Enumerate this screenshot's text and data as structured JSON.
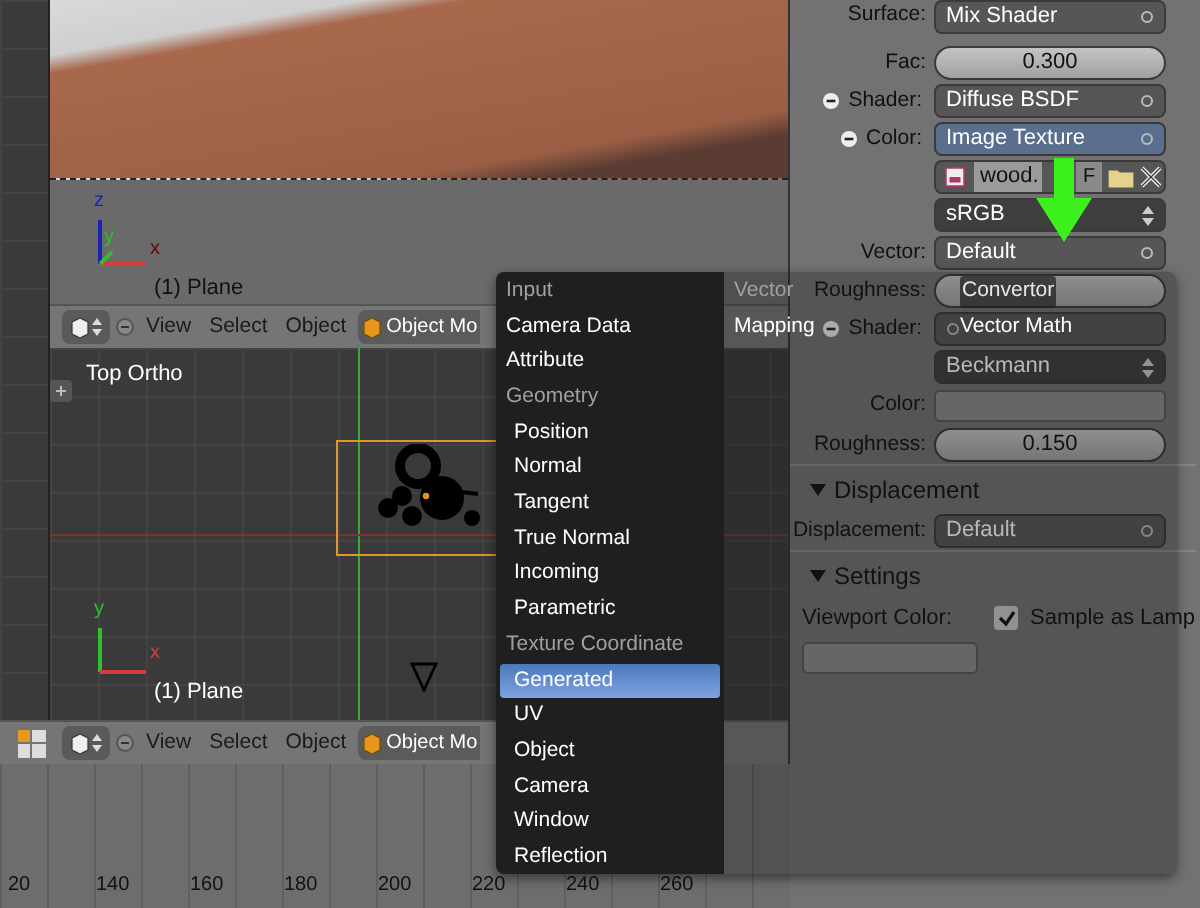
{
  "top_viewport": {
    "axes": [
      "z",
      "y",
      "x"
    ],
    "object_label": "(1) Plane"
  },
  "top_header": {
    "menus": [
      "View",
      "Select",
      "Object"
    ],
    "mode": "Object Mo"
  },
  "bottom_viewport": {
    "view_label": "Top Ortho",
    "axes": [
      "y",
      "x"
    ],
    "object_label": "(1) Plane"
  },
  "bottom_header": {
    "menus": [
      "View",
      "Select",
      "Object"
    ],
    "mode": "Object Mo"
  },
  "timeline": {
    "ticks": [
      "20",
      "140",
      "160",
      "180",
      "200",
      "220",
      "240",
      "260"
    ]
  },
  "properties": [
    {
      "kind": "select",
      "label": "Surface:",
      "value": "Mix Shader",
      "linked": false
    },
    {
      "kind": "number",
      "label": "Fac:",
      "value": "0.300",
      "linked": false
    },
    {
      "kind": "select",
      "label": "Shader:",
      "value": "Diffuse BSDF",
      "linked": true
    },
    {
      "kind": "select",
      "label": "Color:",
      "value": "Image Texture",
      "linked": true,
      "selected": true
    },
    {
      "kind": "image",
      "value": "wood.",
      "flag": "F"
    },
    {
      "kind": "enum",
      "value": "sRGB"
    },
    {
      "kind": "select",
      "label": "Vector:",
      "value": "Default",
      "linked": false
    },
    {
      "kind": "number",
      "label": "Roughness:",
      "linked": false
    },
    {
      "kind": "select",
      "label": "Shader:",
      "linked": true
    },
    {
      "kind": "enum",
      "value": "Beckmann"
    },
    {
      "kind": "color",
      "label": "Color:"
    },
    {
      "kind": "number",
      "label": "Roughness:",
      "value": "0.150",
      "linked": false
    },
    {
      "kind": "header",
      "label": "Displacement",
      "expanded": true
    },
    {
      "kind": "select",
      "label": "Displacement:",
      "value": "Default",
      "linked": false
    },
    {
      "kind": "header",
      "label": "Settings",
      "expanded": true
    },
    {
      "kind": "checkbox",
      "label": "Viewport Color:",
      "check_label": "Sample as Lamp",
      "checked": true
    },
    {
      "kind": "color"
    }
  ],
  "node_menu": {
    "columns": [
      [
        {
          "kind": "header",
          "label": "Input"
        },
        {
          "kind": "item",
          "label": "Camera Data",
          "selected": false
        },
        {
          "kind": "item",
          "label": "Attribute",
          "selected": false
        },
        {
          "kind": "header",
          "label": "Geometry",
          "children": [
            {
              "kind": "item",
              "label": "Position",
              "selected": false
            },
            {
              "kind": "item",
              "label": "Normal",
              "selected": false
            },
            {
              "kind": "item",
              "label": "Tangent",
              "selected": false
            },
            {
              "kind": "item",
              "label": "True Normal",
              "selected": false
            },
            {
              "kind": "item",
              "label": "Incoming",
              "selected": false
            },
            {
              "kind": "item",
              "label": "Parametric",
              "selected": false
            }
          ]
        },
        {
          "kind": "header",
          "label": "Texture Coordinate",
          "children": [
            {
              "kind": "item",
              "label": "Generated",
              "selected": true
            },
            {
              "kind": "item",
              "label": "UV",
              "selected": false
            },
            {
              "kind": "item",
              "label": "Object",
              "selected": false
            },
            {
              "kind": "item",
              "label": "Camera",
              "selected": false
            },
            {
              "kind": "item",
              "label": "Window",
              "selected": false
            },
            {
              "kind": "item",
              "label": "Reflection",
              "selected": false
            }
          ]
        }
      ],
      [
        {
          "kind": "header",
          "label": "Vector"
        },
        {
          "kind": "item",
          "label": "Mapping",
          "selected": false
        }
      ],
      [
        {
          "kind": "header",
          "label": "Convertor"
        },
        {
          "kind": "item",
          "label": "Vector Math",
          "selected": false
        }
      ]
    ]
  }
}
